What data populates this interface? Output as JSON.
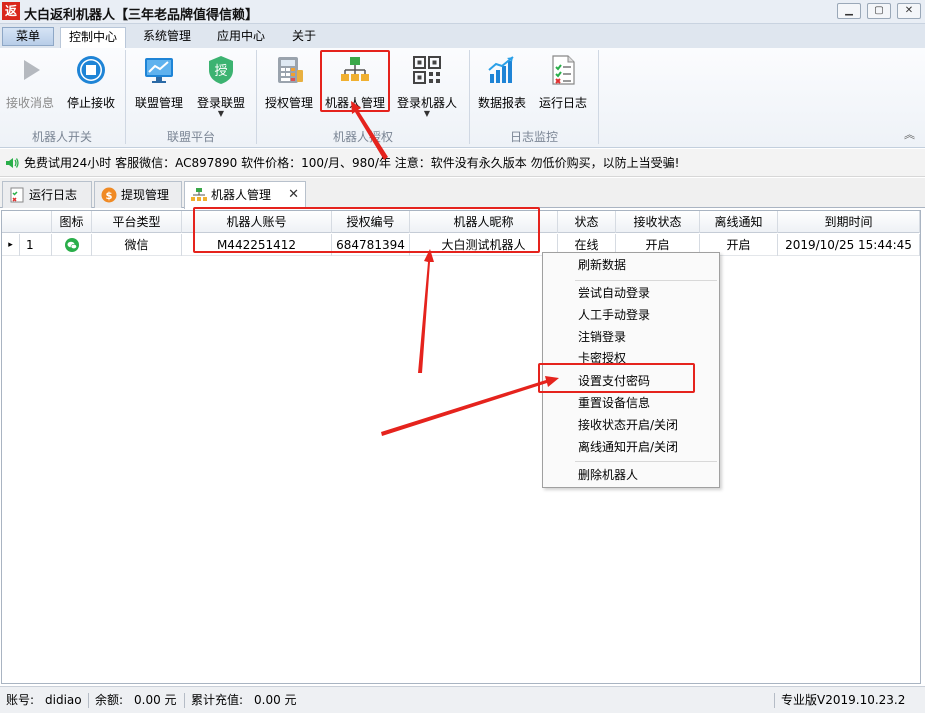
{
  "window": {
    "app_icon_char": "返",
    "title": "大白返利机器人【三年老品牌值得信赖】"
  },
  "ribbon_tabs": {
    "menu": "菜单",
    "tabs": [
      "控制中心",
      "系统管理",
      "应用中心",
      "关于"
    ],
    "active": "控制中心"
  },
  "ribbon": {
    "buttons": {
      "receive": "接收消息",
      "stop_receive": "停止接收",
      "alliance_mgmt": "联盟管理",
      "login_alliance": "登录联盟",
      "auth_mgmt": "授权管理",
      "robot_mgmt": "机器人管理",
      "login_robot": "登录机器人",
      "data_report": "数据报表",
      "run_log": "运行日志"
    },
    "groups": {
      "robot_switch": "机器人开关",
      "alliance_platform": "联盟平台",
      "robot_auth": "机器人授权",
      "log_monitor": "日志监控"
    },
    "icon_glyphs": {
      "login_alliance": "授"
    }
  },
  "notice": "免费试用24小时 客服微信：AC897890 软件价格：100/月、980/年 注意：软件没有永久版本 勿低价购买，以防上当受骗!",
  "doc_tabs": [
    "运行日志",
    "提现管理",
    "机器人管理"
  ],
  "doc_tab_icons": {
    "withdraw": "$"
  },
  "grid": {
    "columns": [
      "图标",
      "平台类型",
      "机器人账号",
      "授权编号",
      "机器人昵称",
      "状态",
      "接收状态",
      "离线通知",
      "到期时间"
    ],
    "rows": [
      {
        "indicator": "▸",
        "index": "1",
        "platform": "微信",
        "account": "M442251412",
        "auth_no": "684781394",
        "nickname": "大白测试机器人",
        "status": "在线",
        "receive_status": "开启",
        "offline_notify": "开启",
        "expire": "2019/10/25 15:44:45"
      }
    ]
  },
  "context_menu": {
    "items": [
      "刷新数据",
      "尝试自动登录",
      "人工手动登录",
      "注销登录",
      "卡密授权",
      "设置支付密码",
      "重置设备信息",
      "接收状态开启/关闭",
      "离线通知开启/关闭",
      "删除机器人"
    ]
  },
  "statusbar": {
    "account_label": "账号:",
    "account": "didiao",
    "balance_label": "余额:",
    "balance": "0.00 元",
    "recharge_label": "累计充值:",
    "recharge": "0.00 元",
    "version": "专业版V2019.10.23.2"
  },
  "colors": {
    "highlight": "#e5231d",
    "wechat_green": "#2aae4a",
    "ribbon_blue": "#1e84d6"
  }
}
